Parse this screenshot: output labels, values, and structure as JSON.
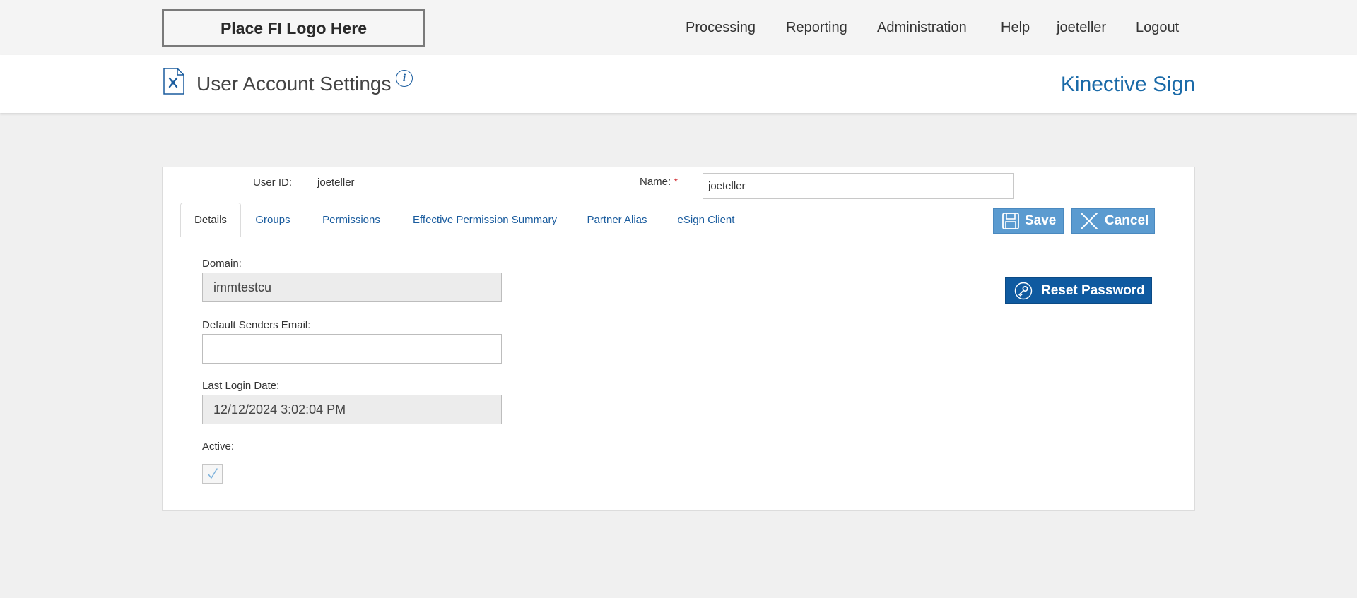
{
  "topbar": {
    "logo_text": "Place FI Logo Here",
    "nav": [
      {
        "label": "Processing"
      },
      {
        "label": "Reporting"
      },
      {
        "label": "Administration"
      },
      {
        "label": "Help"
      },
      {
        "label": "joeteller"
      },
      {
        "label": "Logout"
      }
    ]
  },
  "header": {
    "title": "User Account Settings",
    "info_icon": "i",
    "product": "Kinective Sign"
  },
  "user": {
    "id_label": "User ID:",
    "id_value": "joeteller",
    "name_label": "Name:",
    "name_required": "*",
    "name_value": "joeteller"
  },
  "tabs": [
    {
      "label": "Details",
      "active": true
    },
    {
      "label": "Groups"
    },
    {
      "label": "Permissions"
    },
    {
      "label": "Effective Permission Summary"
    },
    {
      "label": "Partner Alias"
    },
    {
      "label": "eSign Client"
    }
  ],
  "actions": {
    "save_label": "Save",
    "cancel_label": "Cancel",
    "reset_password_label": "Reset Password"
  },
  "details": {
    "domain_label": "Domain:",
    "domain_value": "immtestcu",
    "email_label": "Default Senders Email:",
    "email_value": "",
    "last_login_label": "Last Login Date:",
    "last_login_value": "12/12/2024 3:02:04 PM",
    "active_label": "Active:",
    "active_checked": true
  },
  "colors": {
    "link": "#1a5c9e",
    "button_light": "#5b9bd0",
    "button_dark": "#0f5aa0",
    "required": "#d0282e"
  }
}
